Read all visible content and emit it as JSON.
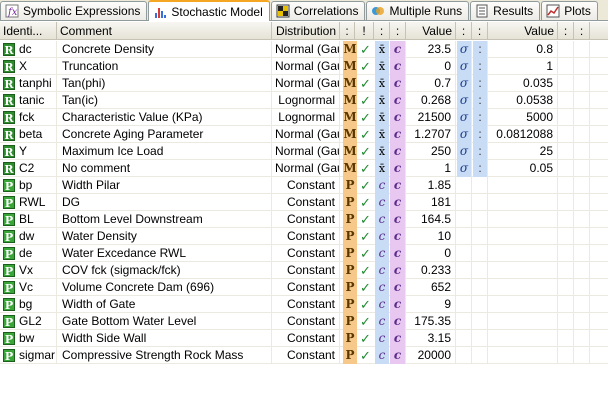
{
  "tabs": [
    {
      "label": "Symbolic Expressions",
      "icon": "fx-icon",
      "active": false
    },
    {
      "label": "Stochastic Model",
      "icon": "histogram-icon",
      "active": true
    },
    {
      "label": "Correlations",
      "icon": "matrix-icon",
      "active": false
    },
    {
      "label": "Multiple Runs",
      "icon": "runs-icon",
      "active": false
    },
    {
      "label": "Results",
      "icon": "results-icon",
      "active": false
    },
    {
      "label": "Plots",
      "icon": "plots-icon",
      "active": false
    }
  ],
  "headers": {
    "ident": "Identi...",
    "comment": "Comment",
    "distribution": "Distribution",
    "colon1": ":",
    "excl": "!",
    "colon2": ":",
    "colon3": ":",
    "value1": "Value",
    "colon4": ":",
    "colon5": ":",
    "value2": "Value",
    "colon6": ":",
    "colon7": ":"
  },
  "rows": [
    {
      "type": "R",
      "id": "dc",
      "comment": "Concrete Density",
      "dist": "Normal (Gauss)",
      "mode": "M",
      "val1": "23.5",
      "sig": "σ",
      "val2": "0.8"
    },
    {
      "type": "R",
      "id": "X",
      "comment": "Truncation",
      "dist": "Normal (Gauss)",
      "mode": "M",
      "val1": "0",
      "sig": "σ",
      "val2": "1"
    },
    {
      "type": "R",
      "id": "tanphi",
      "comment": "Tan(phi)",
      "dist": "Normal (Gauss)",
      "mode": "M",
      "val1": "0.7",
      "sig": "σ",
      "val2": "0.035"
    },
    {
      "type": "R",
      "id": "tanic",
      "comment": "Tan(ic)",
      "dist": "Lognormal",
      "mode": "M",
      "val1": "0.268",
      "sig": "σ",
      "val2": "0.0538"
    },
    {
      "type": "R",
      "id": "fck",
      "comment": "Characteristic Value (KPa)",
      "dist": "Lognormal",
      "mode": "M",
      "val1": "21500",
      "sig": "σ",
      "val2": "5000"
    },
    {
      "type": "R",
      "id": "beta",
      "comment": "Concrete Aging Parameter",
      "dist": "Normal (Gauss)",
      "mode": "M",
      "val1": "1.2707",
      "sig": "σ",
      "val2": "0.0812088"
    },
    {
      "type": "R",
      "id": "Y",
      "comment": "Maximum Ice Load",
      "dist": "Normal (Gauss)",
      "mode": "M",
      "val1": "250",
      "sig": "σ",
      "val2": "25"
    },
    {
      "type": "R",
      "id": "C2",
      "comment": "No comment",
      "dist": "Normal (Gauss)",
      "mode": "M",
      "val1": "1",
      "sig": "σ",
      "val2": "0.05"
    },
    {
      "type": "P",
      "id": "bp",
      "comment": "Width Pilar",
      "dist": "Constant",
      "mode": "P",
      "val1": "1.85",
      "sig": "",
      "val2": ""
    },
    {
      "type": "P",
      "id": "RWL",
      "comment": "DG",
      "dist": "Constant",
      "mode": "P",
      "val1": "181",
      "sig": "",
      "val2": ""
    },
    {
      "type": "P",
      "id": "BL",
      "comment": "Bottom Level Downstream",
      "dist": "Constant",
      "mode": "P",
      "val1": "164.5",
      "sig": "",
      "val2": ""
    },
    {
      "type": "P",
      "id": "dw",
      "comment": "Water Density",
      "dist": "Constant",
      "mode": "P",
      "val1": "10",
      "sig": "",
      "val2": ""
    },
    {
      "type": "P",
      "id": "de",
      "comment": "Water Excedance RWL",
      "dist": "Constant",
      "mode": "P",
      "val1": "0",
      "sig": "",
      "val2": ""
    },
    {
      "type": "P",
      "id": "Vx",
      "comment": "COV fck (sigmack/fck)",
      "dist": "Constant",
      "mode": "P",
      "val1": "0.233",
      "sig": "",
      "val2": ""
    },
    {
      "type": "P",
      "id": "Vc",
      "comment": "Volume Concrete Dam (696)",
      "dist": "Constant",
      "mode": "P",
      "val1": "652",
      "sig": "",
      "val2": ""
    },
    {
      "type": "P",
      "id": "bg",
      "comment": "Width of Gate",
      "dist": "Constant",
      "mode": "P",
      "val1": "9",
      "sig": "",
      "val2": ""
    },
    {
      "type": "P",
      "id": "GL2",
      "comment": "Gate Bottom Water Level",
      "dist": "Constant",
      "mode": "P",
      "val1": "175.35",
      "sig": "",
      "val2": ""
    },
    {
      "type": "P",
      "id": "bw",
      "comment": "Width Side Wall",
      "dist": "Constant",
      "mode": "P",
      "val1": "3.15",
      "sig": "",
      "val2": ""
    },
    {
      "type": "P",
      "id": "sigmar",
      "comment": "Compressive Strength Rock Mass",
      "dist": "Constant",
      "mode": "P",
      "val1": "20000",
      "sig": "",
      "val2": ""
    }
  ],
  "glyphs": {
    "check": "✓",
    "xbar": "x̄",
    "c": "c",
    "colon": ":"
  },
  "colors": {
    "mode_bg": "#f6c98a",
    "blue_bg": "#c8dcf6",
    "purple_bg": "#e8c8f0",
    "badge_green": "#2e8b2e",
    "tab_accent": "#f5a623"
  }
}
